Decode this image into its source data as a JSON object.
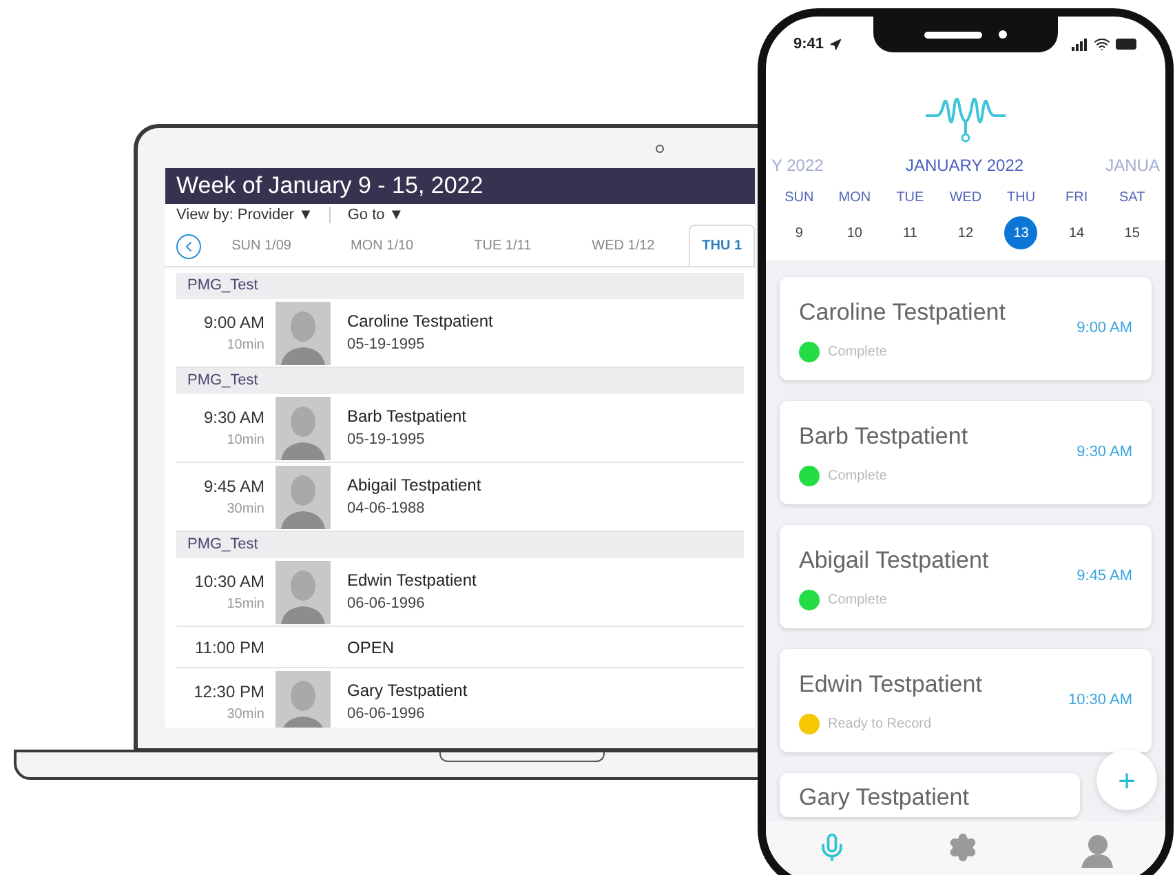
{
  "laptop": {
    "title": "Week of January 9 - 15, 2022",
    "view_by": "View by: Provider ▼",
    "go_to": "Go to ▼",
    "days": [
      {
        "label": "SUN 1/09",
        "selected": false
      },
      {
        "label": "MON 1/10",
        "selected": false
      },
      {
        "label": "TUE 1/11",
        "selected": false
      },
      {
        "label": "WED 1/12",
        "selected": false
      },
      {
        "label": "THU 1",
        "selected": true
      }
    ],
    "rows": [
      {
        "kind": "group",
        "label": "PMG_Test"
      },
      {
        "kind": "appointment",
        "time": "9:00 AM",
        "duration": "10min",
        "name": "Caroline Testpatient",
        "dob": "05-19-1995"
      },
      {
        "kind": "group",
        "label": "PMG_Test"
      },
      {
        "kind": "appointment",
        "time": "9:30 AM",
        "duration": "10min",
        "name": "Barb Testpatient",
        "dob": "05-19-1995"
      },
      {
        "kind": "appointment",
        "time": "9:45 AM",
        "duration": "30min",
        "name": "Abigail Testpatient",
        "dob": "04-06-1988"
      },
      {
        "kind": "group",
        "label": "PMG_Test"
      },
      {
        "kind": "appointment",
        "time": "10:30 AM",
        "duration": "15min",
        "name": "Edwin Testpatient",
        "dob": "06-06-1996"
      },
      {
        "kind": "open",
        "time": "11:00 PM",
        "label": "OPEN"
      },
      {
        "kind": "appointment",
        "time": "12:30 PM",
        "duration": "30min",
        "name": "Gary Testpatient",
        "dob": "06-06-1996"
      }
    ]
  },
  "phone": {
    "status_time": "9:41",
    "month_prev": "Y 2022",
    "month": "JANUARY 2022",
    "month_next": "JANUA",
    "weekdays": [
      "SUN",
      "MON",
      "TUE",
      "WED",
      "THU",
      "FRI",
      "SAT"
    ],
    "dates": [
      {
        "label": "9",
        "selected": false
      },
      {
        "label": "10",
        "selected": false
      },
      {
        "label": "11",
        "selected": false
      },
      {
        "label": "12",
        "selected": false
      },
      {
        "label": "13",
        "selected": true
      },
      {
        "label": "14",
        "selected": false
      },
      {
        "label": "15",
        "selected": false
      }
    ],
    "appointments": [
      {
        "name": "Caroline Testpatient",
        "status": "Complete",
        "color": "#22dd44",
        "time": "9:00 AM"
      },
      {
        "name": "Barb Testpatient",
        "status": "Complete",
        "color": "#22dd44",
        "time": "9:30 AM"
      },
      {
        "name": "Abigail Testpatient",
        "status": "Complete",
        "color": "#22dd44",
        "time": "9:45 AM"
      },
      {
        "name": "Edwin Testpatient",
        "status": "Ready to Record",
        "color": "#f5c800",
        "time": "10:30 AM"
      },
      {
        "name": "Gary Testpatient"
      }
    ],
    "fab": "+",
    "tabs": [
      {
        "kind": "mic",
        "selected": true
      },
      {
        "kind": "settings",
        "selected": false
      },
      {
        "kind": "profile",
        "selected": false
      }
    ]
  }
}
